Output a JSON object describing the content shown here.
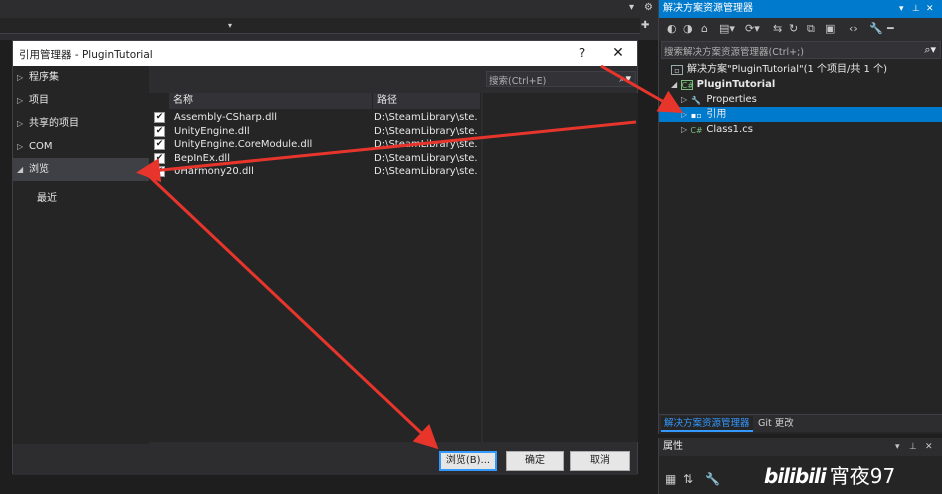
{
  "dialog": {
    "title": "引用管理器 - PluginTutorial",
    "help_glyph": "?",
    "close_glyph": "✕",
    "search_placeholder": "搜索(Ctrl+E)",
    "nav": [
      {
        "label": "程序集",
        "expanded": false
      },
      {
        "label": "项目",
        "expanded": false
      },
      {
        "label": "共享的项目",
        "expanded": false
      },
      {
        "label": "COM",
        "expanded": false
      },
      {
        "label": "浏览",
        "expanded": true,
        "selected": true
      }
    ],
    "nav_sub": "最近",
    "columns": {
      "name": "名称",
      "path": "路径"
    },
    "rows": [
      {
        "name": "Assembly-CSharp.dll",
        "path": "D:\\SteamLibrary\\ste...",
        "checked": true
      },
      {
        "name": "UnityEngine.dll",
        "path": "D:\\SteamLibrary\\ste...",
        "checked": true
      },
      {
        "name": "UnityEngine.CoreModule.dll",
        "path": "D:\\SteamLibrary\\ste...",
        "checked": true
      },
      {
        "name": "BepInEx.dll",
        "path": "D:\\SteamLibrary\\ste...",
        "checked": true
      },
      {
        "name": "0Harmony20.dll",
        "path": "D:\\SteamLibrary\\ste...",
        "checked": true
      }
    ],
    "buttons": {
      "browse": "浏览(B)...",
      "ok": "确定",
      "cancel": "取消"
    }
  },
  "solution_explorer": {
    "title": "解决方案资源管理器",
    "search_placeholder": "搜索解决方案资源管理器(Ctrl+;)",
    "solution": "解决方案\"PluginTutorial\"(1 个项目/共 1 个)",
    "project": "PluginTutorial",
    "items": [
      "Properties",
      "引用",
      "Class1.cs"
    ],
    "tabs": [
      "解决方案资源管理器",
      "Git 更改"
    ]
  },
  "properties": {
    "title": "属性"
  },
  "watermark": {
    "logo": "bilibili",
    "author": "宵夜97"
  },
  "colors": {
    "accent": "#007acc",
    "arrow": "#e8352c",
    "background": "#1e1e1e"
  }
}
